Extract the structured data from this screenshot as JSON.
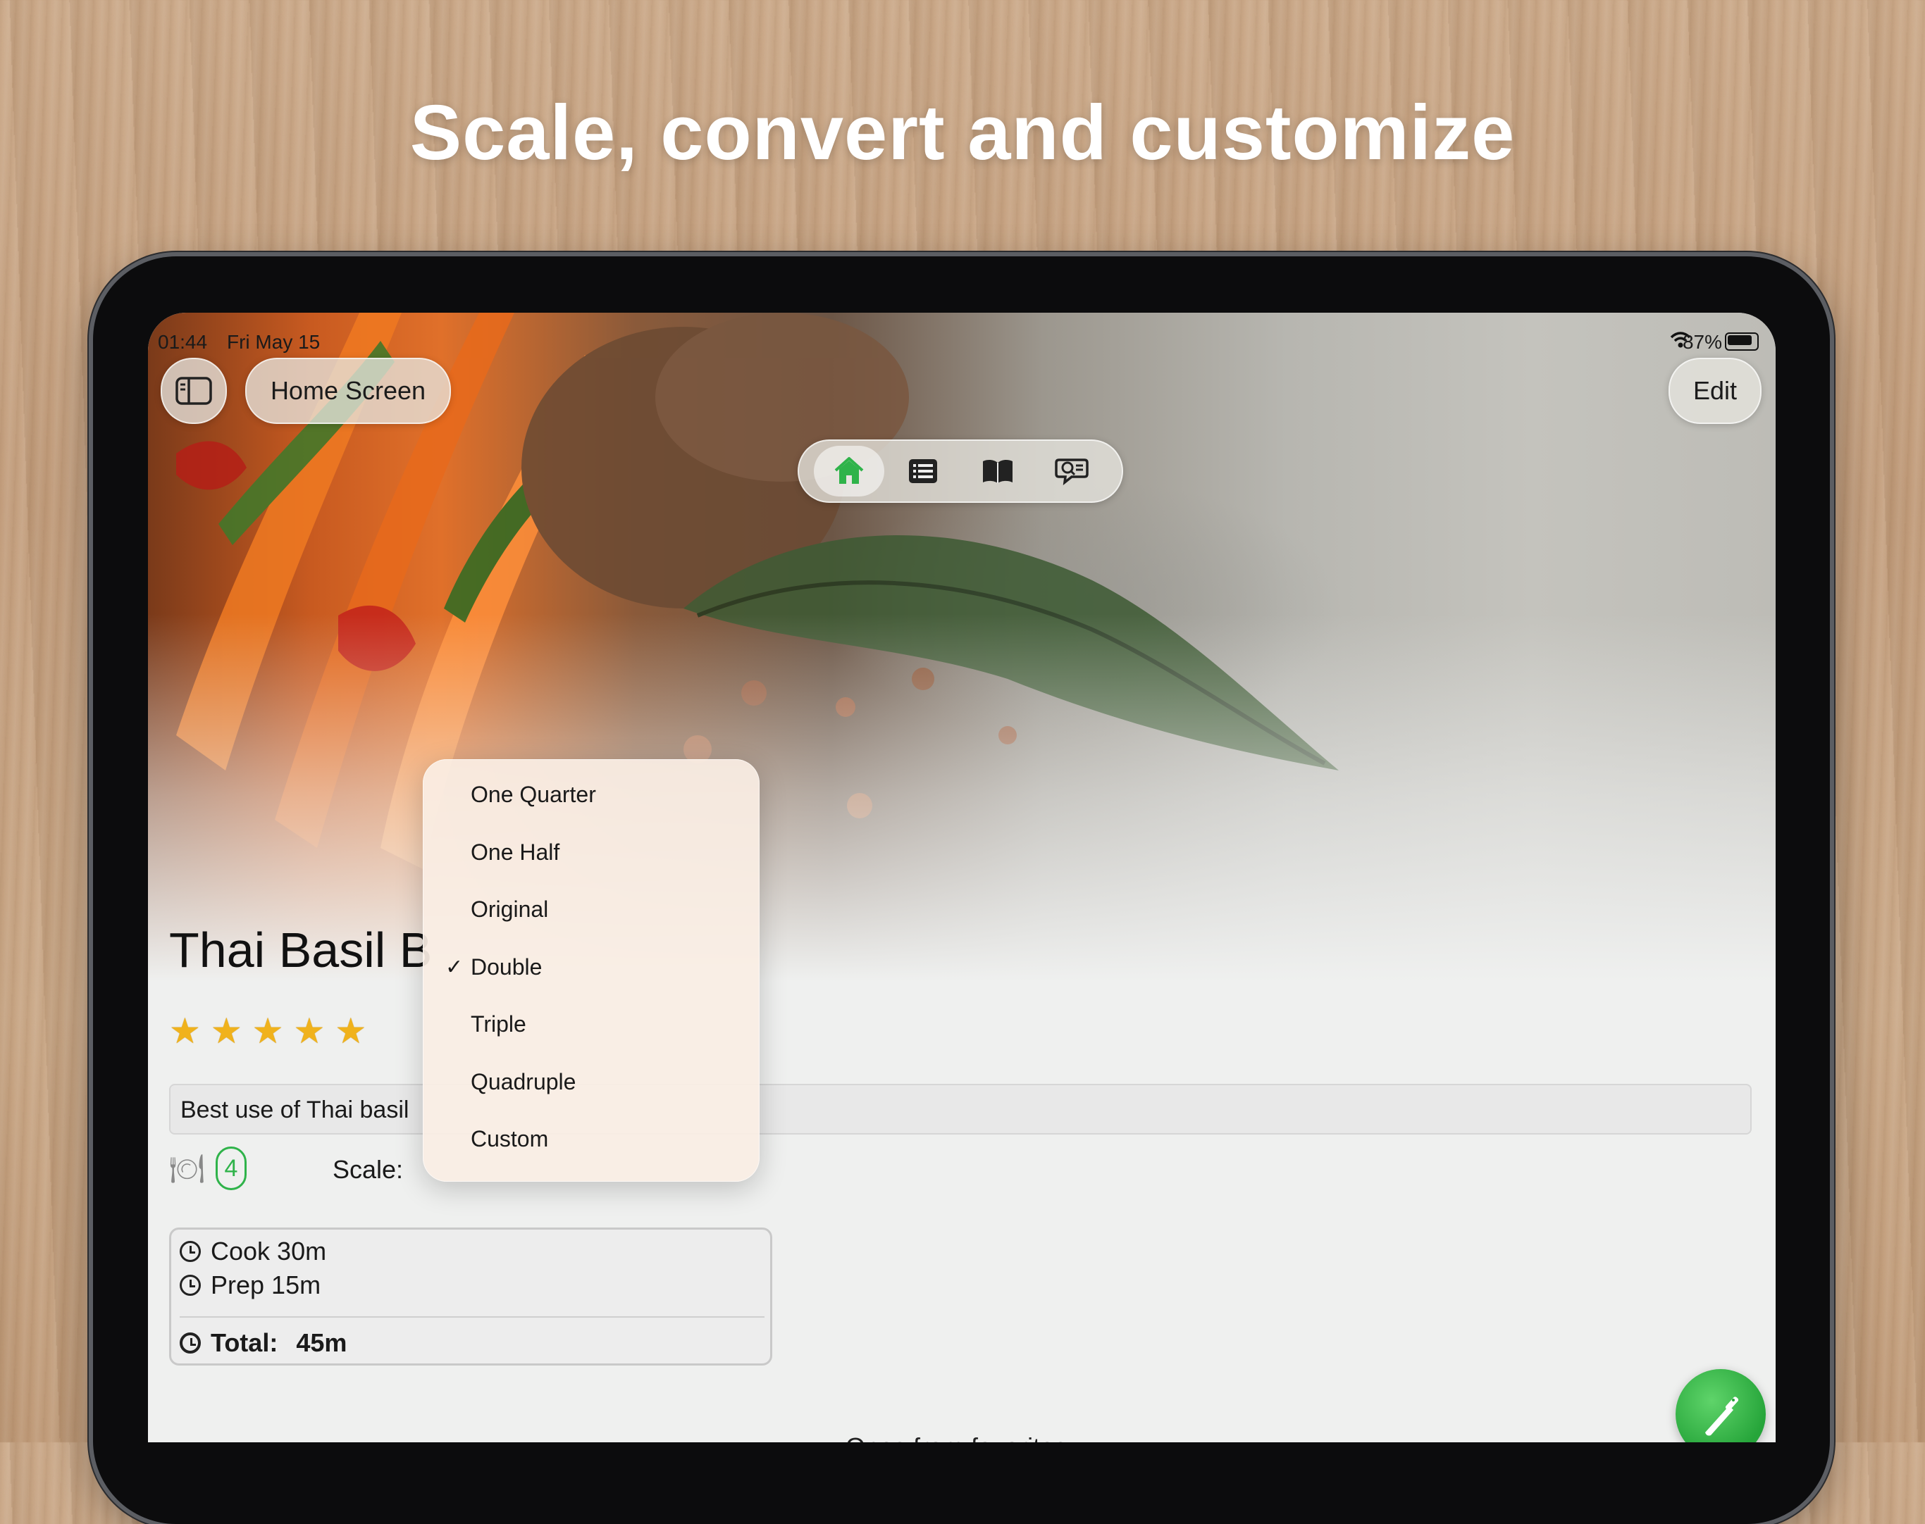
{
  "headline": "Scale, convert and customize",
  "status_bar": {
    "time": "01:44",
    "date": "Fri May 15",
    "battery": "87%"
  },
  "nav": {
    "home_screen_label": "Home Screen",
    "edit_label": "Edit",
    "tabs": [
      {
        "icon": "home-icon",
        "active": true
      },
      {
        "icon": "list-icon",
        "active": false
      },
      {
        "icon": "book-icon",
        "active": false
      },
      {
        "icon": "search-comment-icon",
        "active": false
      }
    ]
  },
  "recipe": {
    "title": "Thai Basil B",
    "rating": 5,
    "description": "Best use of Thai basil",
    "servings": "4",
    "scale_label": "Scale:",
    "times": {
      "cook": "Cook  30m",
      "prep": "Prep  15m",
      "total_label": "Total:",
      "total_value": "45m"
    },
    "footer_partial": "Ones from favorites"
  },
  "scale_menu": {
    "selected": "Double",
    "options": [
      "One Quarter",
      "One Half",
      "Original",
      "Double",
      "Triple",
      "Quadruple",
      "Custom"
    ]
  },
  "colors": {
    "accent_green": "#2fb34a",
    "star_gold": "#f0b21c"
  }
}
